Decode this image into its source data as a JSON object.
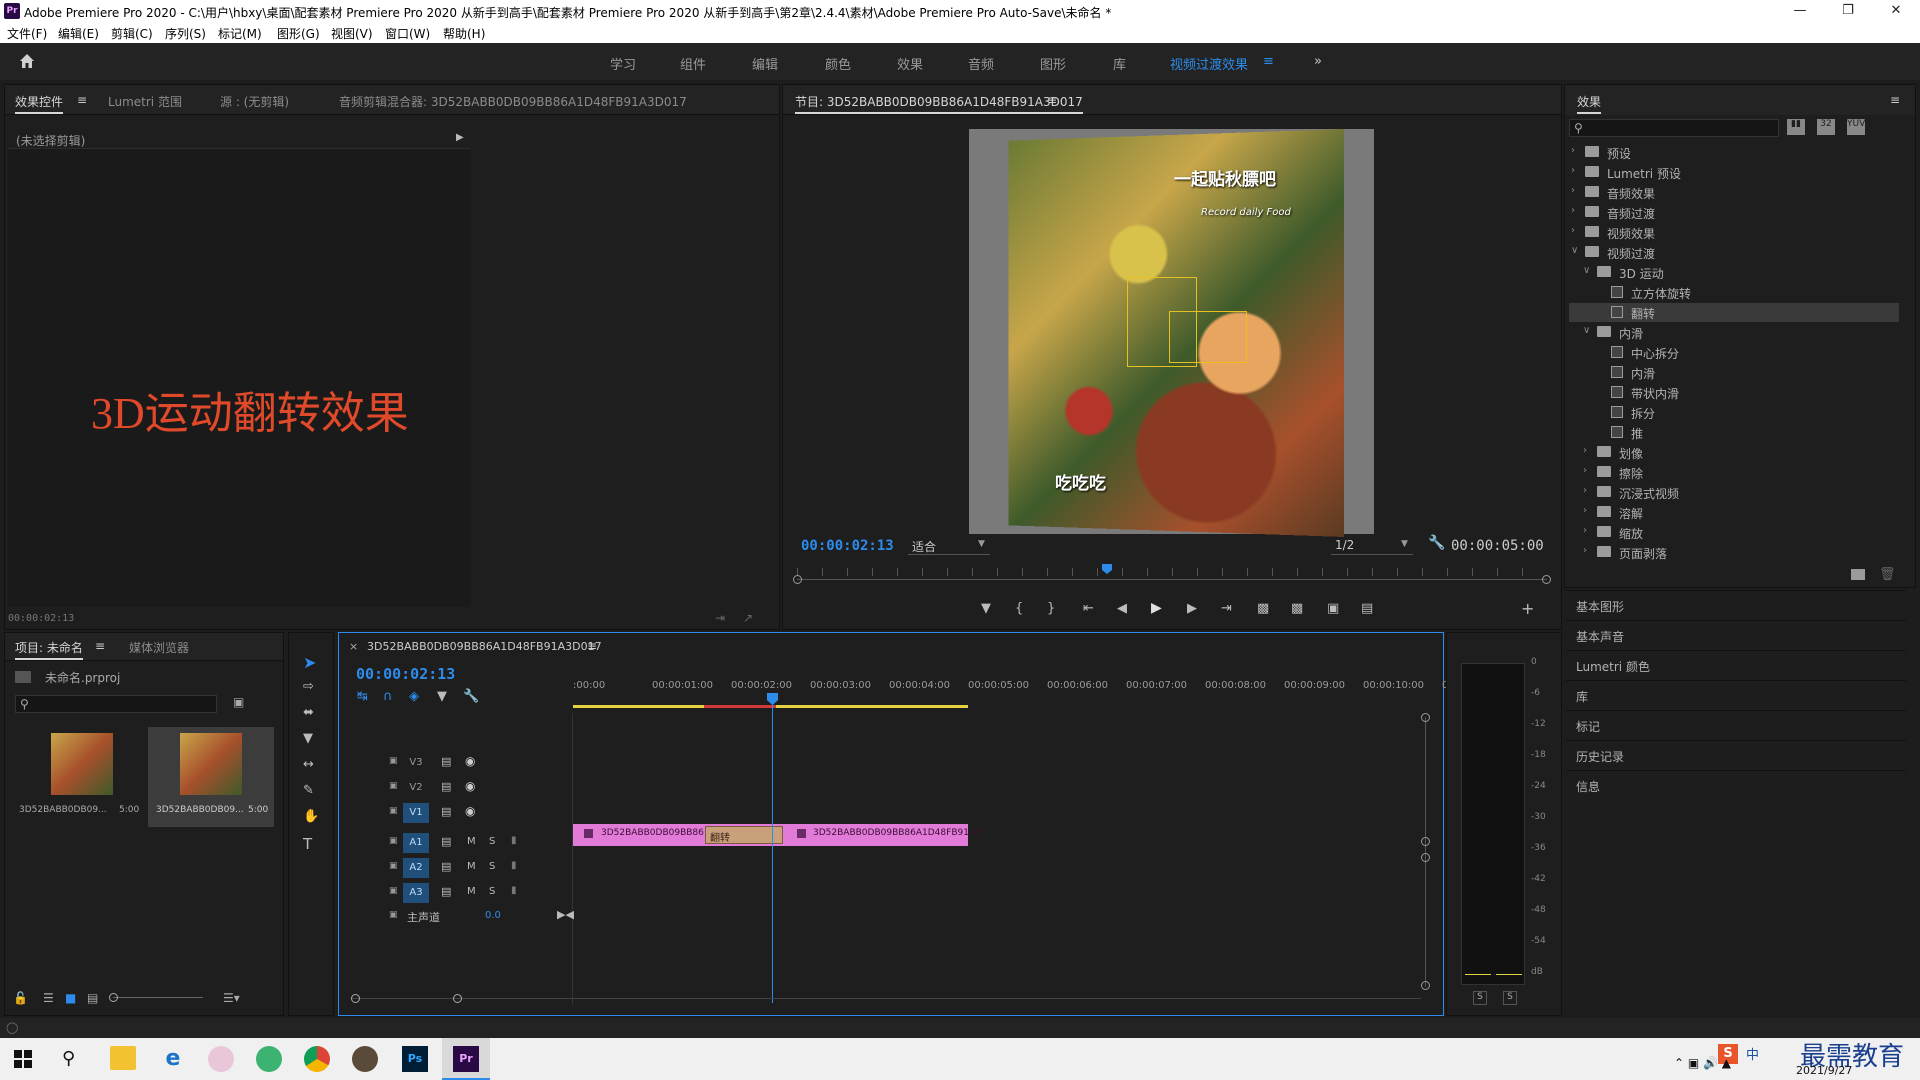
{
  "window": {
    "title": "Adobe Premiere Pro 2020 - C:\\用户\\hbxy\\桌面\\配套素材 Premiere Pro 2020 从新手到高手\\配套素材 Premiere Pro 2020 从新手到高手\\第2章\\2.4.4\\素材\\Adobe Premiere Pro Auto-Save\\未命名 *",
    "logo": "Pr"
  },
  "menu": [
    "文件(F)",
    "编辑(E)",
    "剪辑(C)",
    "序列(S)",
    "标记(M)",
    "图形(G)",
    "视图(V)",
    "窗口(W)",
    "帮助(H)"
  ],
  "workspaces": [
    "学习",
    "组件",
    "编辑",
    "颜色",
    "效果",
    "音频",
    "图形",
    "库",
    "视频过渡效果"
  ],
  "source_panel": {
    "tabs": [
      "效果控件",
      "Lumetri 范围",
      "源 : (无剪辑)",
      "音频剪辑混合器: 3D52BABB0DB09BB86A1D48FB91A3D017"
    ],
    "no_clip": "(未选择剪辑)",
    "overlay_text": "3D运动翻转效果",
    "timecode": "00:00:02:13"
  },
  "program_monitor": {
    "title": "节目: 3D52BABB0DB09BB86A1D48FB91A3D017",
    "caption_top": "一起贴秋膘吧",
    "caption_sub": "Record daily Food",
    "caption_bottom": "吃吃吃",
    "timecode": "00:00:02:13",
    "fit": "适合",
    "resolution": "1/2",
    "duration": "00:00:05:00",
    "playhead_fraction": 0.5
  },
  "effects_panel": {
    "title": "效果",
    "tree": [
      {
        "label": "预设",
        "level": 0,
        "type": "folder",
        "open": false
      },
      {
        "label": "Lumetri 预设",
        "level": 0,
        "type": "folder",
        "open": false
      },
      {
        "label": "音频效果",
        "level": 0,
        "type": "folder",
        "open": false
      },
      {
        "label": "音频过渡",
        "level": 0,
        "type": "folder",
        "open": false
      },
      {
        "label": "视频效果",
        "level": 0,
        "type": "folder",
        "open": false
      },
      {
        "label": "视频过渡",
        "level": 0,
        "type": "folder",
        "open": true
      },
      {
        "label": "3D 运动",
        "level": 1,
        "type": "folder",
        "open": true
      },
      {
        "label": "立方体旋转",
        "level": 2,
        "type": "fx"
      },
      {
        "label": "翻转",
        "level": 2,
        "type": "fx",
        "selected": true
      },
      {
        "label": "内滑",
        "level": 1,
        "type": "folder",
        "open": true
      },
      {
        "label": "中心拆分",
        "level": 2,
        "type": "fx"
      },
      {
        "label": "内滑",
        "level": 2,
        "type": "fx"
      },
      {
        "label": "带状内滑",
        "level": 2,
        "type": "fx"
      },
      {
        "label": "拆分",
        "level": 2,
        "type": "fx"
      },
      {
        "label": "推",
        "level": 2,
        "type": "fx"
      },
      {
        "label": "划像",
        "level": 1,
        "type": "folder",
        "open": false
      },
      {
        "label": "擦除",
        "level": 1,
        "type": "folder",
        "open": false
      },
      {
        "label": "沉浸式视频",
        "level": 1,
        "type": "folder",
        "open": false
      },
      {
        "label": "溶解",
        "level": 1,
        "type": "folder",
        "open": false
      },
      {
        "label": "缩放",
        "level": 1,
        "type": "folder",
        "open": false
      },
      {
        "label": "页面剥落",
        "level": 1,
        "type": "folder",
        "open": false
      }
    ],
    "side_panels": [
      "基本图形",
      "基本声音",
      "Lumetri 颜色",
      "库",
      "标记",
      "历史记录",
      "信息"
    ]
  },
  "project_panel": {
    "tabs": [
      "项目: 未命名",
      "媒体浏览器"
    ],
    "file": "未命名.prproj",
    "clips": [
      {
        "name": "3D52BABB0DB09...",
        "duration": "5:00"
      },
      {
        "name": "3D52BABB0DB09...",
        "duration": "5:00"
      }
    ]
  },
  "timeline": {
    "sequence_name": "3D52BABB0DB09BB86A1D48FB91A3D017",
    "timecode": "00:00:02:13",
    "ruler": [
      ":00:00",
      "00:00:01:00",
      "00:00:02:00",
      "00:00:03:00",
      "00:00:04:00",
      "00:00:05:00",
      "00:00:06:00",
      "00:00:07:00",
      "00:00:08:00",
      "00:00:09:00",
      "00:00:10:00",
      "0"
    ],
    "tracks": [
      "V3",
      "V2",
      "V1",
      "A1",
      "A2",
      "A3"
    ],
    "master_label": "主声道",
    "master_value": "0.0",
    "clip1": "3D52BABB0DB09BB86",
    "transition": "翻转",
    "clip2": "3D52BABB0DB09BB86A1D48FB91A3",
    "audio_m": "M",
    "audio_s": "S"
  },
  "meter": {
    "scale": [
      "0",
      "-6",
      "-12",
      "-18",
      "-24",
      "-30",
      "-36",
      "-42",
      "-48",
      "-54",
      "dB"
    ],
    "solo": [
      "S",
      "S"
    ]
  },
  "taskbar": {
    "date": "2021/9/27",
    "watermark": "最需教育",
    "ime": "中"
  }
}
